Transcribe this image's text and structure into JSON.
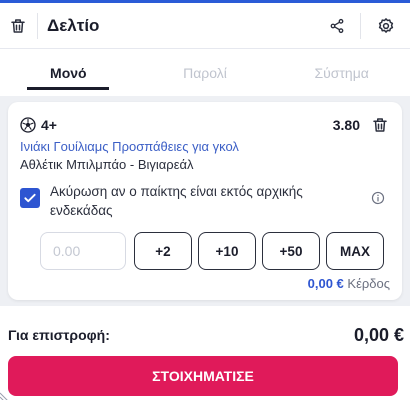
{
  "header": {
    "title": "Δελτίο",
    "icons": {
      "delete": "trash-icon",
      "share": "share-icon",
      "settings": "gear-icon"
    }
  },
  "tabs": [
    {
      "label": "Μονό",
      "active": true
    },
    {
      "label": "Παρολί",
      "active": false
    },
    {
      "label": "Σύστημα",
      "active": false
    }
  ],
  "bet": {
    "selection": "4+",
    "odds": "3.80",
    "market": "Ινιάκι Γουίλιαμς Προσπάθειες για γκολ",
    "match": "Αθλέτικ Μπιλμπάο - Βιγιαρεάλ",
    "void_checkbox_label": "Ακύρωση αν ο παίκτης είναι εκτός αρχικής ενδεκάδας",
    "void_checked": true,
    "stake_placeholder": "0.00",
    "quick_stakes": [
      "+2",
      "+10",
      "+50",
      "MAX"
    ],
    "profit_amount": "0,00 €",
    "profit_label": "Κέρδος"
  },
  "footer": {
    "return_label": "Για επιστροφή:",
    "return_value": "0,00 €",
    "place_button": "ΣΤΟΙΧΗΜΑΤΙΣΕ"
  },
  "colors": {
    "accent_blue": "#2e55d1",
    "place_button": "#e01a5a",
    "top_line": "#2a5bd7"
  }
}
